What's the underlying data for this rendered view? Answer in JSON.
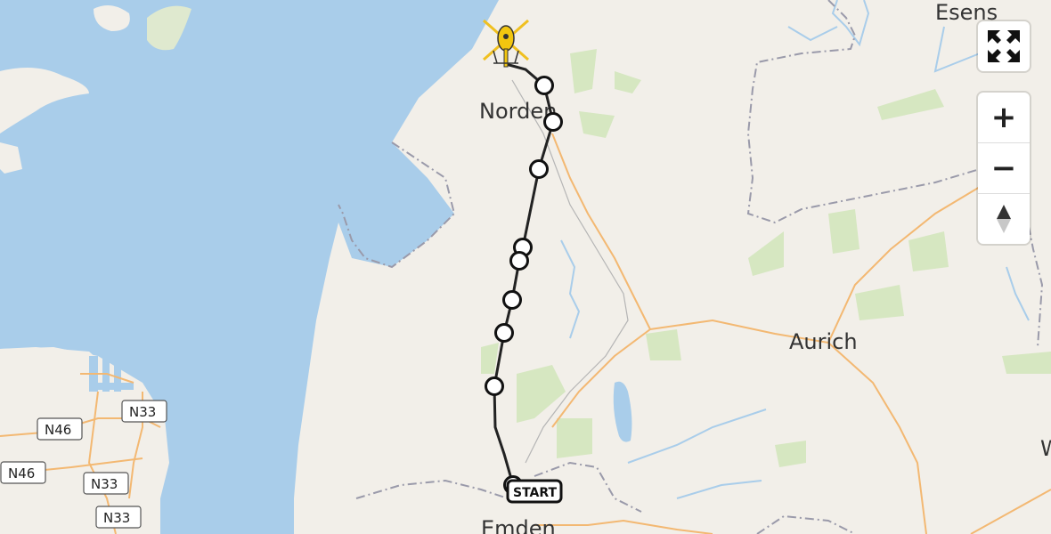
{
  "places": {
    "norden": "Norden",
    "emden": "Emden",
    "aurich": "Aurich",
    "esens": "Esens",
    "w_partial": "W"
  },
  "road_labels": {
    "n46_a": "N46",
    "n46_b": "N46",
    "n33_a": "N33",
    "n33_b": "N33",
    "n33_c": "N33"
  },
  "route": {
    "start_label": "START",
    "waypoint_count": 11,
    "line_color": "#222222",
    "end_icon": "helicopter-icon"
  },
  "controls": {
    "fullscreen_icon": "fullscreen-icon",
    "zoom_in": "+",
    "zoom_out": "−",
    "compass_icon": "compass-icon"
  },
  "colors": {
    "water": "#a9cdea",
    "land": "#f2efe9",
    "forest": "#cfe3b6",
    "road_major": "#f3b872",
    "boundary": "#9a9aaa"
  }
}
